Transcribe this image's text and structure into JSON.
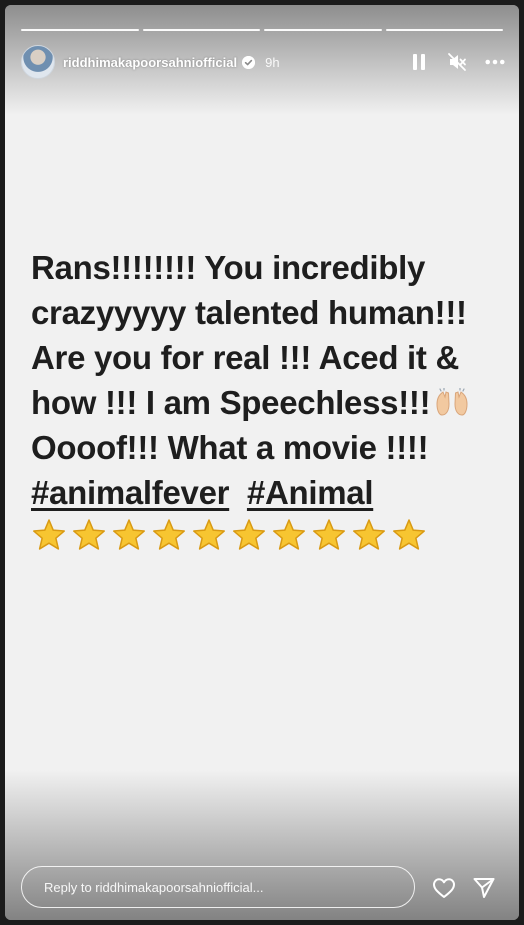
{
  "header": {
    "username": "riddhimakapoorsahniofficial",
    "time": "9h",
    "progress_segments": 4
  },
  "icons": {
    "avatar": "profile-avatar",
    "verified": "verified-badge-icon",
    "pause": "pause-icon",
    "mute": "mute-icon",
    "more": "more-options-icon",
    "like": "heart-icon",
    "share": "send-icon",
    "hands": "raising-hands-emoji",
    "star": "star-emoji"
  },
  "story": {
    "line1": "Rans!!!!!!!! You incredibly",
    "line2": "crazyyyyy talented human!!!",
    "line3": "Are you for real !!! Aced it &",
    "line4": "how !!! I am Speechless!!!",
    "line5": "Oooof!!! What a movie !!!!",
    "hashtag1": "#animalfever",
    "hashtag2": "#Animal",
    "star_count": 10
  },
  "reply": {
    "placeholder": "Reply to riddhimakapoorsahniofficial..."
  },
  "colors": {
    "background": "#f1f1f1",
    "text": "#1e1e1e",
    "outer": "#1b1b1b",
    "star": "#f7c531"
  }
}
